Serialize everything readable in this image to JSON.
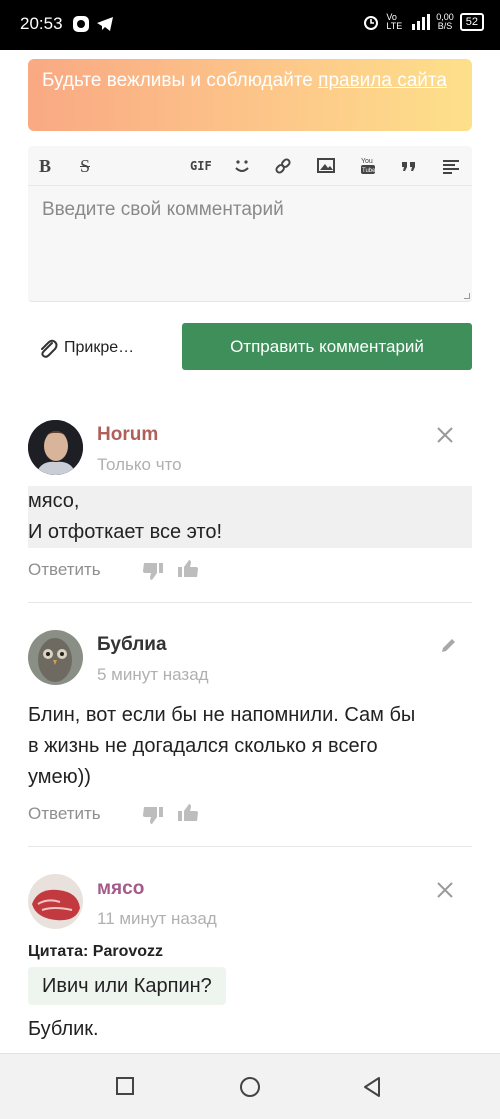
{
  "status_bar": {
    "time": "20:53",
    "network_speed": "0,00",
    "network_unit": "B/S",
    "battery": "52"
  },
  "banner": {
    "text": "Будьте вежливы и соблюдайте ",
    "link": "правила сайта",
    "colors": {
      "from": "#f9a983",
      "to": "#fde08a"
    }
  },
  "editor": {
    "toolbar": {
      "bold": "B",
      "strike": "S",
      "gif": "GIF",
      "icons": [
        "bold-icon",
        "strikethrough-icon",
        "gif-icon",
        "emoji-icon",
        "link-icon",
        "image-icon",
        "youtube-icon",
        "quote-icon",
        "align-icon"
      ]
    },
    "placeholder": "Введите свой комментарий"
  },
  "actions": {
    "attach_label": "Прикре…",
    "send_label": "Отправить комментарий",
    "send_color": "#3f8f5a"
  },
  "comments": [
    {
      "author": "Horum",
      "author_color": "#b0605a",
      "time": "Только что",
      "lines": [
        "мясо,",
        "И отфоткает все это!"
      ],
      "reply": "Ответить",
      "action_icon": "close-icon"
    },
    {
      "author": "Бублиа",
      "author_color": "#333333",
      "time": "5 минут назад",
      "lines": [
        "Блин, вот если бы не напомнили. Сам бы",
        "в жизнь не догадался сколько я всего",
        "умею))"
      ],
      "reply": "Ответить",
      "action_icon": "edit-icon"
    },
    {
      "author": "мясо",
      "author_color": "#a45a8a",
      "time": "11 минут назад",
      "quote_author": "Цитата: Parovozz",
      "quote": "Ивич или Карпин?",
      "lines": [
        "Бублик."
      ],
      "action_icon": "close-icon"
    }
  ]
}
